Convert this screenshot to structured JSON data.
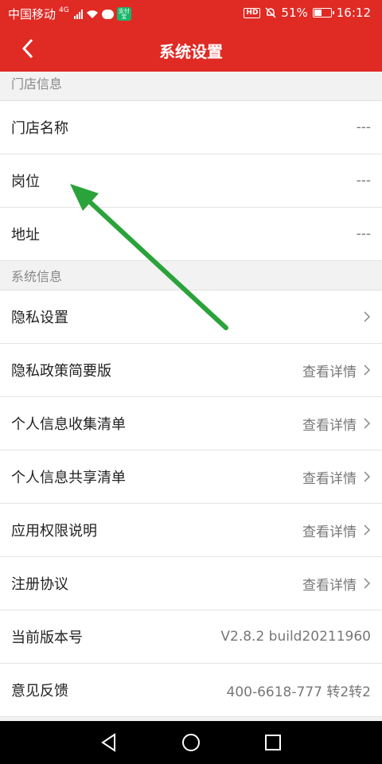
{
  "status_bar": {
    "carrier": "中国移动",
    "network": "4G",
    "app_icon_text": "支付宝",
    "hd": "HD",
    "battery": "51%",
    "battery_level": 0.51,
    "time": "16:12"
  },
  "header": {
    "title": "系统设置",
    "back_icon": "chevron-left-icon"
  },
  "sections": {
    "store": {
      "title": "门店信息",
      "rows": [
        {
          "label": "门店名称",
          "value": "---"
        },
        {
          "label": "岗位",
          "value": "---"
        },
        {
          "label": "地址",
          "value": "---"
        }
      ]
    },
    "system": {
      "title": "系统信息",
      "rows": [
        {
          "label": "隐私设置",
          "value": ""
        },
        {
          "label": "隐私政策简要版",
          "value": "查看详情"
        },
        {
          "label": "个人信息收集清单",
          "value": "查看详情"
        },
        {
          "label": "个人信息共享清单",
          "value": "查看详情"
        },
        {
          "label": "应用权限说明",
          "value": "查看详情"
        },
        {
          "label": "注册协议",
          "value": "查看详情"
        },
        {
          "label": "当前版本号",
          "value": "V2.8.2 build20211960"
        },
        {
          "label": "意见反馈",
          "value": "400-6618-777 转2转2"
        }
      ]
    }
  },
  "annotation": {
    "type": "arrow",
    "color": "#2aa33a"
  },
  "colors": {
    "accent": "#e02a24"
  },
  "system_nav": [
    "back-triangle-icon",
    "home-circle-icon",
    "recents-square-icon"
  ]
}
